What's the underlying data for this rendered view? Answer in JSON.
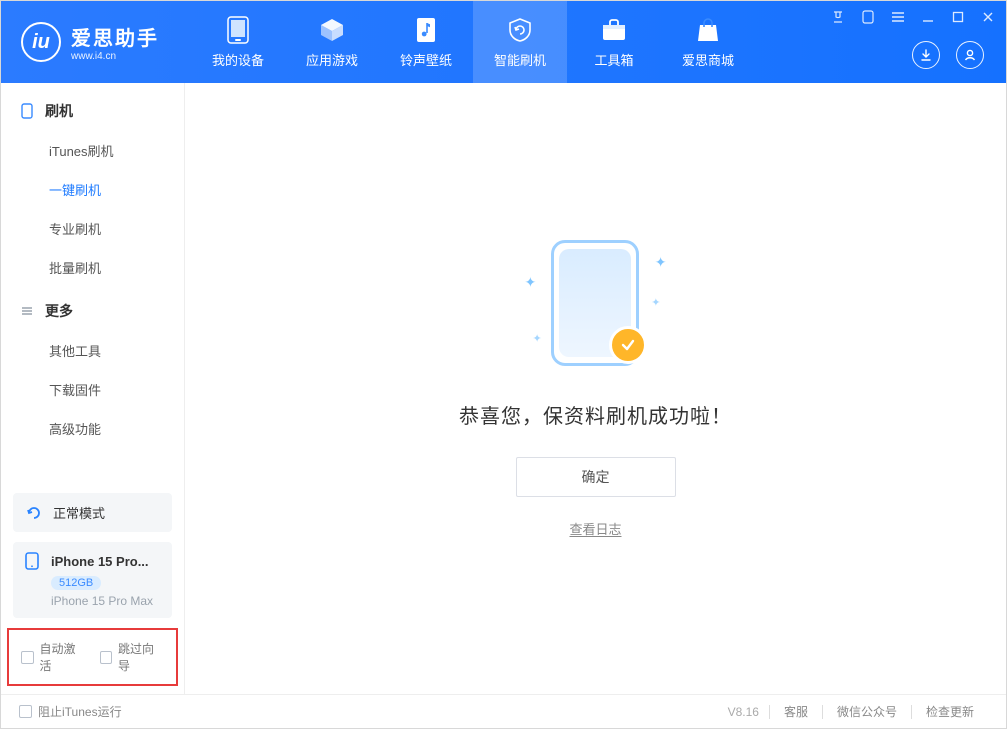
{
  "brand": {
    "title": "爱思助手",
    "subtitle": "www.i4.cn"
  },
  "tabs": [
    {
      "label": "我的设备"
    },
    {
      "label": "应用游戏"
    },
    {
      "label": "铃声壁纸"
    },
    {
      "label": "智能刷机"
    },
    {
      "label": "工具箱"
    },
    {
      "label": "爱思商城"
    }
  ],
  "sidebar": {
    "groups": [
      {
        "title": "刷机",
        "items": [
          "iTunes刷机",
          "一键刷机",
          "专业刷机",
          "批量刷机"
        ]
      },
      {
        "title": "更多",
        "items": [
          "其他工具",
          "下载固件",
          "高级功能"
        ]
      }
    ],
    "mode_label": "正常模式",
    "device": {
      "name": "iPhone 15 Pro...",
      "storage": "512GB",
      "model": "iPhone 15 Pro Max"
    },
    "cb_auto_activate": "自动激活",
    "cb_skip_guide": "跳过向导"
  },
  "main": {
    "success_text": "恭喜您，保资料刷机成功啦！",
    "ok_button": "确定",
    "view_log": "查看日志"
  },
  "footer": {
    "block_itunes": "阻止iTunes运行",
    "version": "V8.16",
    "links": [
      "客服",
      "微信公众号",
      "检查更新"
    ]
  }
}
